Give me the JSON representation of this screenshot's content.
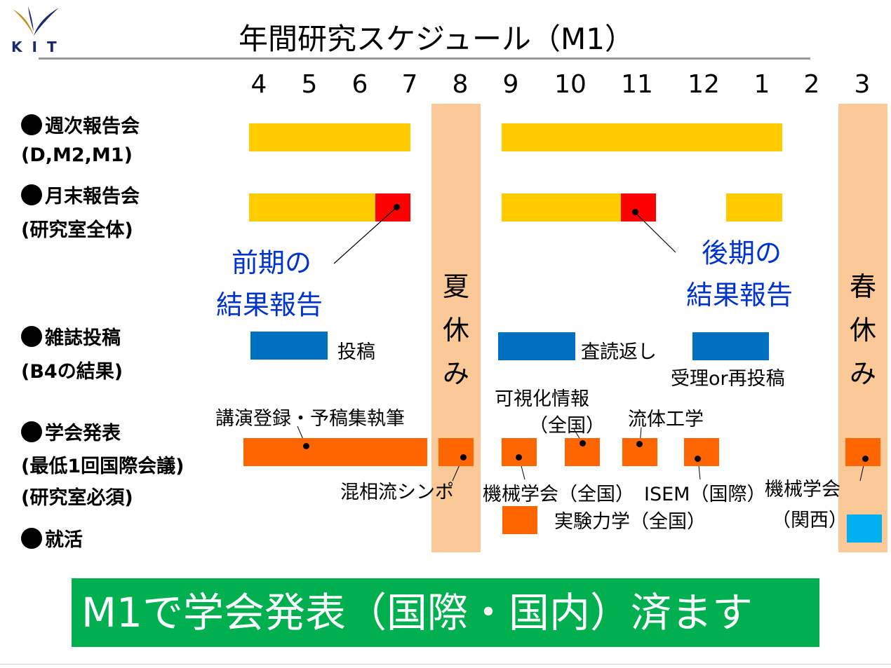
{
  "logo": {
    "text": "KIT",
    "colors": [
      "#c08a1a",
      "#1a2a6a"
    ]
  },
  "title": "年間研究スケジュール（M1）",
  "months": [
    "4",
    "5",
    "6",
    "7",
    "8",
    "9",
    "10",
    "11",
    "12",
    "1",
    "2",
    "3"
  ],
  "rows": {
    "weekly": {
      "line1": "週次報告会",
      "line2": "(D,M2,M1)"
    },
    "monthly": {
      "line1": "月末報告会",
      "line2": "(研究室全体)"
    },
    "journal": {
      "line1": "雑誌投稿",
      "line2": "(B4の結果)"
    },
    "conference": {
      "line1": "学会発表",
      "line2": "(最低1回国際会議)",
      "line3": "(研究室必須)"
    },
    "jobhunt": {
      "line1": "就活"
    }
  },
  "vacations": {
    "summer": [
      "夏",
      "休",
      "み"
    ],
    "spring": [
      "春",
      "休",
      "み"
    ]
  },
  "results": {
    "first_half": [
      "前期の",
      "結果報告"
    ],
    "second_half": [
      "後期の",
      "結果報告"
    ]
  },
  "journal_labels": {
    "submit": "投稿",
    "reply": "査読返し",
    "accept": "受理or再投稿"
  },
  "conference_labels": {
    "registration": "講演登録・予稿集執筆",
    "mixed_flow": "混相流シンポ",
    "visualization_line1": "可視化情報",
    "visualization_line2": "（全国）",
    "fluid_eng": "流体工学",
    "jsme_national": "機械学会（全国）",
    "isem": "ISEM（国際）",
    "jsme_kansai_line1": "機械学会",
    "jsme_kansai_line2": "（関西）",
    "exp_mechanics": "実験力学（全国）"
  },
  "banner": "M1で学会発表（国際・国内）済ます",
  "colors": {
    "weekly": "#ffcc00",
    "monthly_result": "#ff0000",
    "journal": "#0070c0",
    "conference": "#ff6600",
    "jobhunt": "#00b0f0",
    "vacation": "#fbc898",
    "result_text": "#0033cc",
    "banner": "#00b050"
  }
}
